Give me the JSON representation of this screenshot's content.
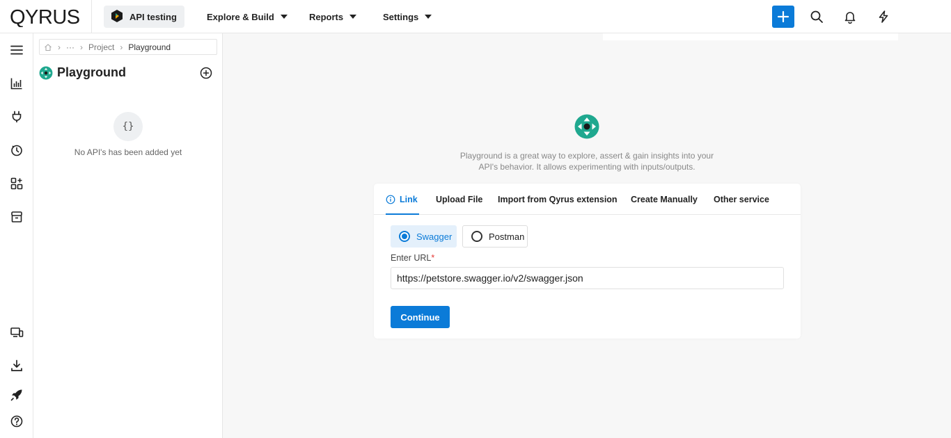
{
  "header": {
    "logo_text": "QYRUS",
    "product": "API testing",
    "nav": [
      "Explore & Build",
      "Reports",
      "Settings"
    ],
    "icons": [
      "plus-icon",
      "search-icon",
      "bell-icon",
      "lightning-icon"
    ]
  },
  "rail": {
    "icons": [
      "menu-icon",
      "analytics-icon",
      "plug-icon",
      "history-icon",
      "add-apps-icon",
      "storage-icon",
      "devices-icon",
      "download-icon",
      "rocket-icon",
      "help-icon"
    ]
  },
  "panel": {
    "breadcrumb": [
      "Project",
      "Playground"
    ],
    "breadcrumb_ellipsis": "···",
    "title": "Playground",
    "empty_glyph": "{}",
    "empty_text": "No API's has been added yet"
  },
  "main": {
    "description_line1": "Playground is a great way to explore, assert & gain insights into your",
    "description_line2": "API's behavior. It allows experimenting with inputs/outputs.",
    "tabs": [
      "Link",
      "Upload File",
      "Import from Qyrus extension",
      "Create Manually",
      "Other service"
    ],
    "active_tab": "Link",
    "source_options": [
      "Swagger",
      "Postman"
    ],
    "selected_source": "Swagger",
    "url_label": "Enter URL",
    "url_required_mark": "*",
    "url_value": "https://petstore.swagger.io/v2/swagger.json",
    "continue_label": "Continue"
  },
  "colors": {
    "accent": "#0b7bd8",
    "brand_teal": "#1fa88f",
    "required": "#e53935"
  }
}
